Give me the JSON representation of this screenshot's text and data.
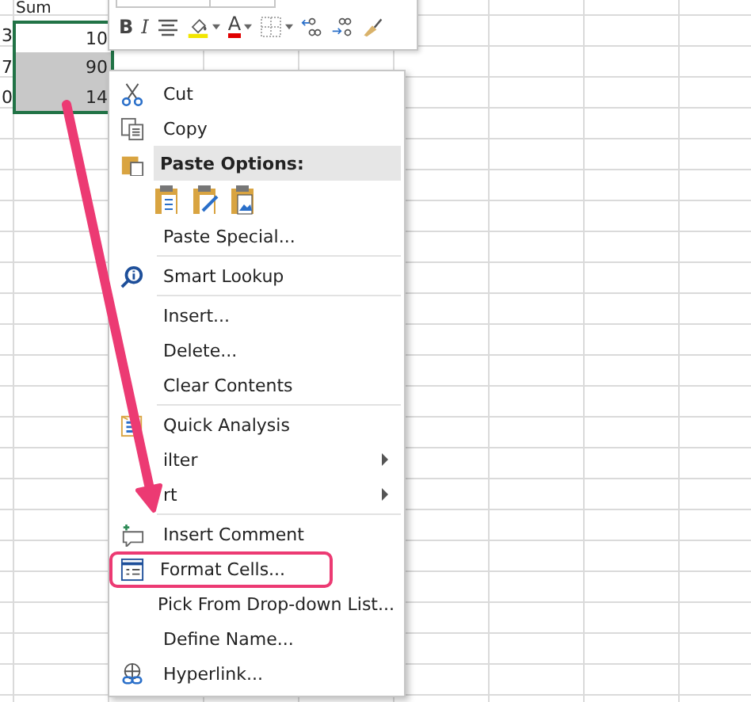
{
  "sheet": {
    "header": "Sum",
    "rows": [
      {
        "column_1": "3",
        "sum": "10",
        "selected": false
      },
      {
        "column_1": "7",
        "sum": "90",
        "selected": true
      },
      {
        "column_1": "0",
        "sum": "14",
        "selected": true
      }
    ]
  },
  "mini_toolbar": {
    "bold": "B",
    "italic": "I",
    "font_color_letter": "A"
  },
  "context_menu": {
    "items": [
      {
        "kind": "item",
        "label": "Cut"
      },
      {
        "kind": "item",
        "label": "Copy"
      },
      {
        "kind": "header",
        "label": "Paste Options:"
      },
      {
        "kind": "paste_icons"
      },
      {
        "kind": "item",
        "label": "Paste Special..."
      },
      {
        "kind": "separator"
      },
      {
        "kind": "item",
        "label": "Smart Lookup"
      },
      {
        "kind": "separator"
      },
      {
        "kind": "item",
        "label": "Insert..."
      },
      {
        "kind": "item",
        "label": "Delete..."
      },
      {
        "kind": "item",
        "label": "Clear Contents"
      },
      {
        "kind": "separator"
      },
      {
        "kind": "item",
        "label": "Quick Analysis"
      },
      {
        "kind": "submenu",
        "label": "ilter"
      },
      {
        "kind": "submenu",
        "label": "rt"
      },
      {
        "kind": "separator"
      },
      {
        "kind": "item",
        "label": "Insert Comment"
      },
      {
        "kind": "item",
        "label": "Format Cells...",
        "highlighted": true
      },
      {
        "kind": "item",
        "label": "Pick From Drop-down List..."
      },
      {
        "kind": "item",
        "label": "Define Name..."
      },
      {
        "kind": "item",
        "label": "Hyperlink..."
      }
    ]
  }
}
